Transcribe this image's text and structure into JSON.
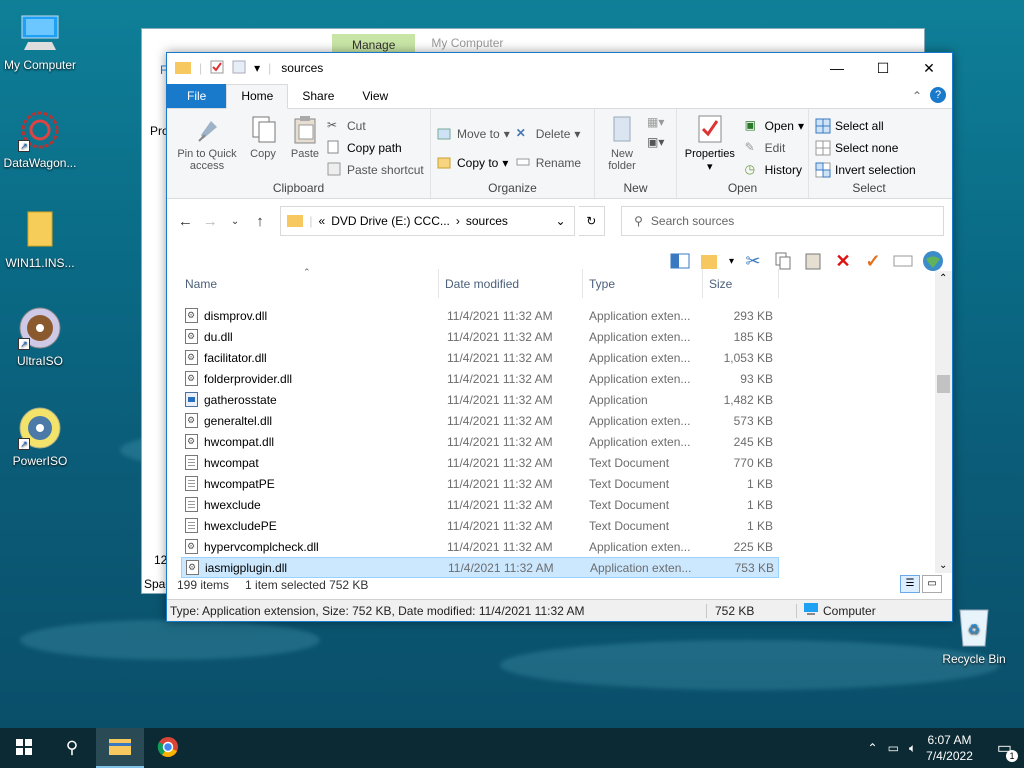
{
  "desktop": {
    "icons": [
      {
        "label": "My Computer"
      },
      {
        "label": "DataWagon..."
      },
      {
        "label": "WIN11.INS..."
      },
      {
        "label": "UltraISO"
      },
      {
        "label": "PowerISO"
      },
      {
        "label": "Recycle Bin"
      }
    ]
  },
  "background_window": {
    "manage_tab": "Manage",
    "title": "My Computer",
    "left_text_f": "F",
    "left_text_pro": "Pro",
    "left_text_num": "12",
    "left_text_spac": "Spac"
  },
  "window": {
    "title": "sources",
    "tabs": {
      "file": "File",
      "home": "Home",
      "share": "Share",
      "view": "View"
    },
    "ribbon": {
      "clipboard": {
        "pin": "Pin to Quick access",
        "copy": "Copy",
        "paste": "Paste",
        "cut": "Cut",
        "copy_path": "Copy path",
        "paste_shortcut": "Paste shortcut",
        "label": "Clipboard"
      },
      "organize": {
        "move_to": "Move to",
        "copy_to": "Copy to",
        "delete": "Delete",
        "rename": "Rename",
        "label": "Organize"
      },
      "new": {
        "new_folder": "New folder",
        "label": "New"
      },
      "open": {
        "properties": "Properties",
        "open": "Open",
        "edit": "Edit",
        "history": "History",
        "label": "Open"
      },
      "select": {
        "select_all": "Select all",
        "select_none": "Select none",
        "invert": "Invert selection",
        "label": "Select"
      }
    },
    "address": {
      "prefix": "«",
      "drive": "DVD Drive (E:) CCC...",
      "sep": "›",
      "folder": "sources"
    },
    "search_placeholder": "Search sources",
    "columns": {
      "name": "Name",
      "date": "Date modified",
      "type": "Type",
      "size": "Size"
    },
    "files": [
      {
        "name": "dismprov.dll",
        "date": "11/4/2021 11:32 AM",
        "type": "Application exten...",
        "size": "293 KB",
        "kind": "dll"
      },
      {
        "name": "du.dll",
        "date": "11/4/2021 11:32 AM",
        "type": "Application exten...",
        "size": "185 KB",
        "kind": "dll"
      },
      {
        "name": "facilitator.dll",
        "date": "11/4/2021 11:32 AM",
        "type": "Application exten...",
        "size": "1,053 KB",
        "kind": "dll"
      },
      {
        "name": "folderprovider.dll",
        "date": "11/4/2021 11:32 AM",
        "type": "Application exten...",
        "size": "93 KB",
        "kind": "dll"
      },
      {
        "name": "gatherosstate",
        "date": "11/4/2021 11:32 AM",
        "type": "Application",
        "size": "1,482 KB",
        "kind": "app"
      },
      {
        "name": "generaltel.dll",
        "date": "11/4/2021 11:32 AM",
        "type": "Application exten...",
        "size": "573 KB",
        "kind": "dll"
      },
      {
        "name": "hwcompat.dll",
        "date": "11/4/2021 11:32 AM",
        "type": "Application exten...",
        "size": "245 KB",
        "kind": "dll"
      },
      {
        "name": "hwcompat",
        "date": "11/4/2021 11:32 AM",
        "type": "Text Document",
        "size": "770 KB",
        "kind": "txt"
      },
      {
        "name": "hwcompatPE",
        "date": "11/4/2021 11:32 AM",
        "type": "Text Document",
        "size": "1 KB",
        "kind": "txt"
      },
      {
        "name": "hwexclude",
        "date": "11/4/2021 11:32 AM",
        "type": "Text Document",
        "size": "1 KB",
        "kind": "txt"
      },
      {
        "name": "hwexcludePE",
        "date": "11/4/2021 11:32 AM",
        "type": "Text Document",
        "size": "1 KB",
        "kind": "txt"
      },
      {
        "name": "hypervcomplcheck.dll",
        "date": "11/4/2021 11:32 AM",
        "type": "Application exten...",
        "size": "225 KB",
        "kind": "dll"
      },
      {
        "name": "iasmigplugin.dll",
        "date": "11/4/2021 11:32 AM",
        "type": "Application exten...",
        "size": "753 KB",
        "kind": "dll",
        "selected": true
      }
    ],
    "status": {
      "items": "199 items",
      "selected": "1 item selected  752 KB"
    },
    "details_bar": {
      "info": "Type: Application extension, Size: 752 KB, Date modified: 11/4/2021 11:32 AM",
      "size": "752 KB",
      "location": "Computer"
    }
  },
  "taskbar": {
    "time": "6:07 AM",
    "date": "7/4/2022",
    "notification_count": "1"
  },
  "colors": {
    "accent": "#1979ca",
    "selection": "#cce8ff",
    "taskbar": "#0c2a33"
  }
}
